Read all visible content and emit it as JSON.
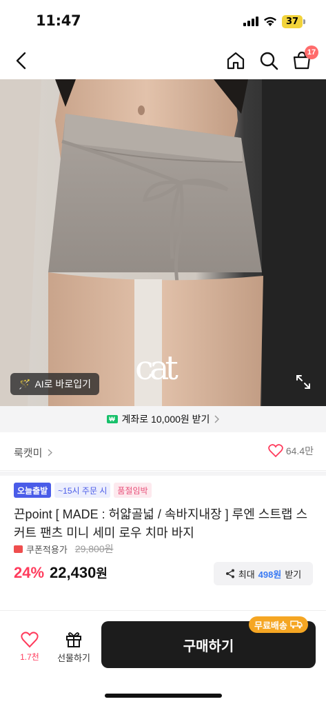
{
  "status_bar": {
    "time": "11:47",
    "battery": "37"
  },
  "nav": {
    "cart_count": "17"
  },
  "hero": {
    "ai_button_label": "AI로 바로입기",
    "logo_text": "cat"
  },
  "cashback": {
    "badge": "₩",
    "text": "계좌로 10,000원 받기"
  },
  "store": {
    "name": "룩캣미",
    "likes": "64.4만"
  },
  "tags": [
    "오늘출발",
    "~15시 주문 시",
    "품절임박"
  ],
  "product": {
    "title": "끈point [ MADE : 허얇골넓 / 속바지내장 ] 루엔 스트랩 스커트 팬츠 미니 세미 로우 치마 바지",
    "coupon_label": "쿠폰적용가",
    "original_price": "29,800원",
    "discount": "24%",
    "price": "22,430",
    "currency": "원"
  },
  "reward": {
    "prefix": "최대",
    "amount": "498원",
    "suffix": "받기"
  },
  "bottom": {
    "like_count": "1.7천",
    "gift_label": "선물하기",
    "buy_label": "구매하기",
    "free_shipping": "무료배송"
  },
  "colors": {
    "accent_red": "#ff3b5c",
    "tag_blue": "#4a5ce8",
    "free_ship_orange": "#f5a623",
    "reward_blue": "#3b7bf3"
  }
}
